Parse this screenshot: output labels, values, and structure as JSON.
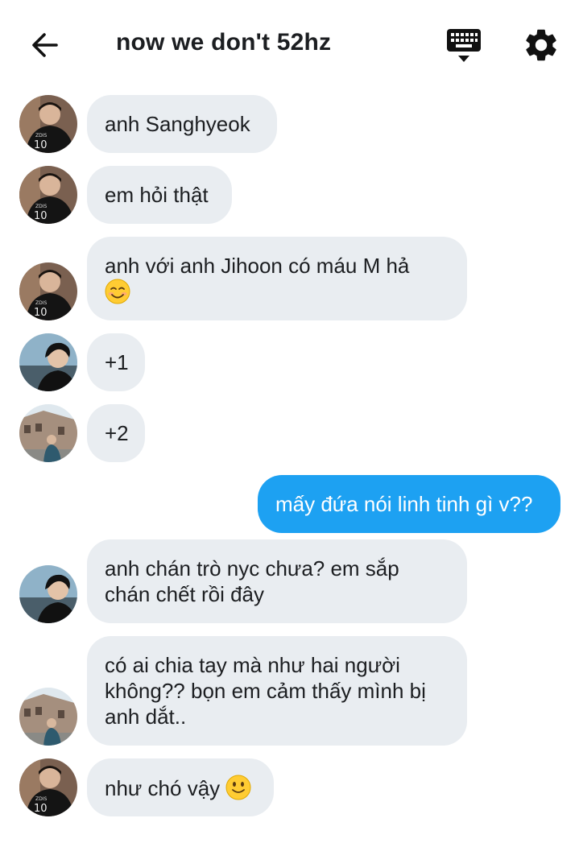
{
  "header": {
    "title": "now we don't 52hz"
  },
  "messages": [
    {
      "sender": "sanghyeok",
      "text": "anh Sanghyeok"
    },
    {
      "sender": "sanghyeok",
      "text": "em hỏi thật"
    },
    {
      "sender": "sanghyeok",
      "text": "anh với anh Jihoon có máu M hả",
      "emoji": "smiling-face-emoji"
    },
    {
      "sender": "member-b",
      "text": "+1"
    },
    {
      "sender": "member-c",
      "text": "+2"
    },
    {
      "sender": "me",
      "text": "mấy đứa nói linh tinh gì v??"
    },
    {
      "sender": "member-b",
      "line1": "anh chán trò nyc chưa? em sắp",
      "line2": "chán chết rồi đây"
    },
    {
      "sender": "member-c",
      "line1": "có ai chia tay mà như hai người",
      "line2": "không?? bọn em cảm thấy mình bị",
      "line3": "anh dắt.."
    },
    {
      "sender": "sanghyeok",
      "text": "như chó vậy",
      "emoji": "slightly-smiling-face-emoji"
    }
  ],
  "colors": {
    "incoming_bubble": "#e9edf1",
    "outgoing_bubble": "#1da1f2",
    "text": "#1c1e21"
  }
}
